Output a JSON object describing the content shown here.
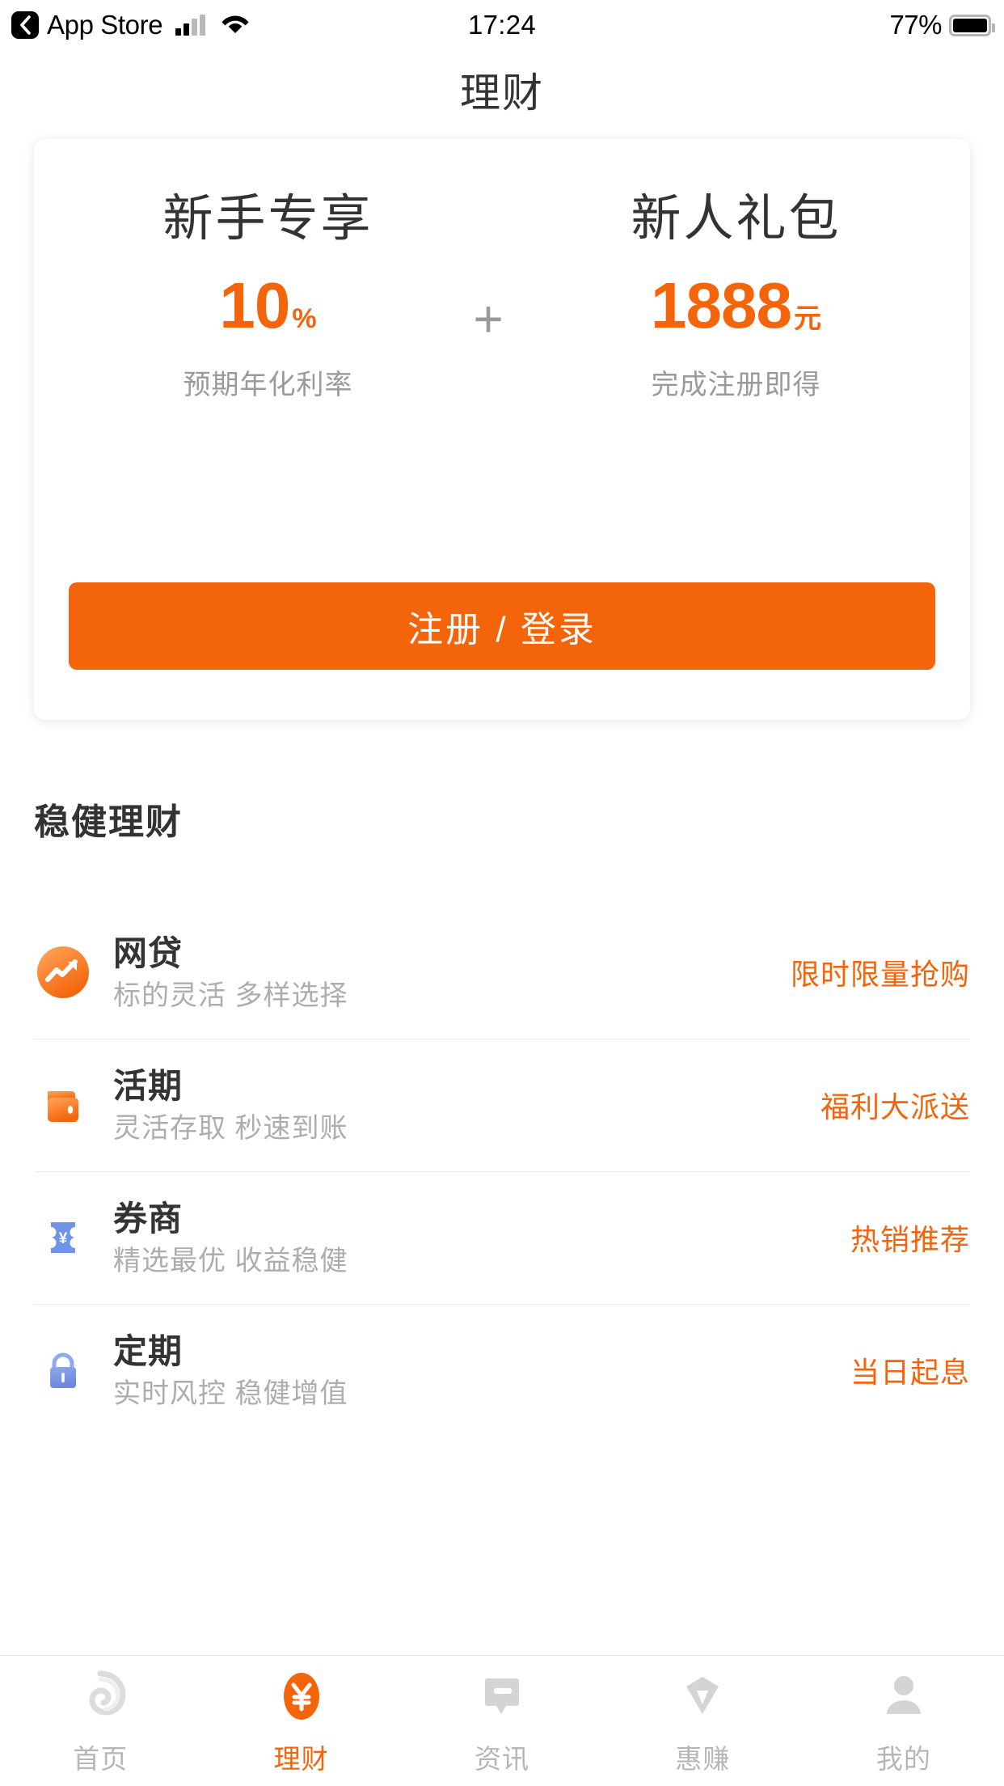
{
  "status_bar": {
    "back_label": "App Store",
    "back_icon": "chevron-left-icon",
    "signal_icon": "cellular-signal-icon",
    "wifi_icon": "wifi-icon",
    "time": "17:24",
    "battery_percent": "77%",
    "battery_icon": "battery-icon"
  },
  "nav": {
    "title": "理财"
  },
  "promo": {
    "left": {
      "heading": "新手专享",
      "value": "10",
      "unit": "%",
      "sub": "预期年化利率"
    },
    "separator": "+",
    "right": {
      "heading": "新人礼包",
      "value": "1888",
      "unit": "元",
      "sub": "完成注册即得"
    },
    "cta_label": "注册 / 登录"
  },
  "section": {
    "title": "稳健理财"
  },
  "products": [
    {
      "icon": "trending-up-circle-icon",
      "title": "网贷",
      "desc": "标的灵活  多样选择",
      "tag": "限时限量抢购"
    },
    {
      "icon": "wallet-icon",
      "title": "活期",
      "desc": "灵活存取 秒速到账",
      "tag": "福利大派送"
    },
    {
      "icon": "ticket-yuan-icon",
      "title": "券商",
      "desc": "精选最优 收益稳健",
      "tag": "热销推荐"
    },
    {
      "icon": "lock-icon",
      "title": "定期",
      "desc": "实时风控 稳健增值",
      "tag": "当日起息"
    }
  ],
  "tabs": [
    {
      "icon": "spiral-home-icon",
      "label": "首页",
      "active": false
    },
    {
      "icon": "yuan-oval-icon",
      "label": "理财",
      "active": true
    },
    {
      "icon": "news-icon",
      "label": "资讯",
      "active": false
    },
    {
      "icon": "pen-nib-icon",
      "label": "惠赚",
      "active": false
    },
    {
      "icon": "person-icon",
      "label": "我的",
      "active": false
    }
  ],
  "colors": {
    "accent": "#F4640B",
    "text_primary": "#333333",
    "text_muted": "#adadad",
    "tab_inactive": "#b6b6b6",
    "divider": "#ececec"
  }
}
